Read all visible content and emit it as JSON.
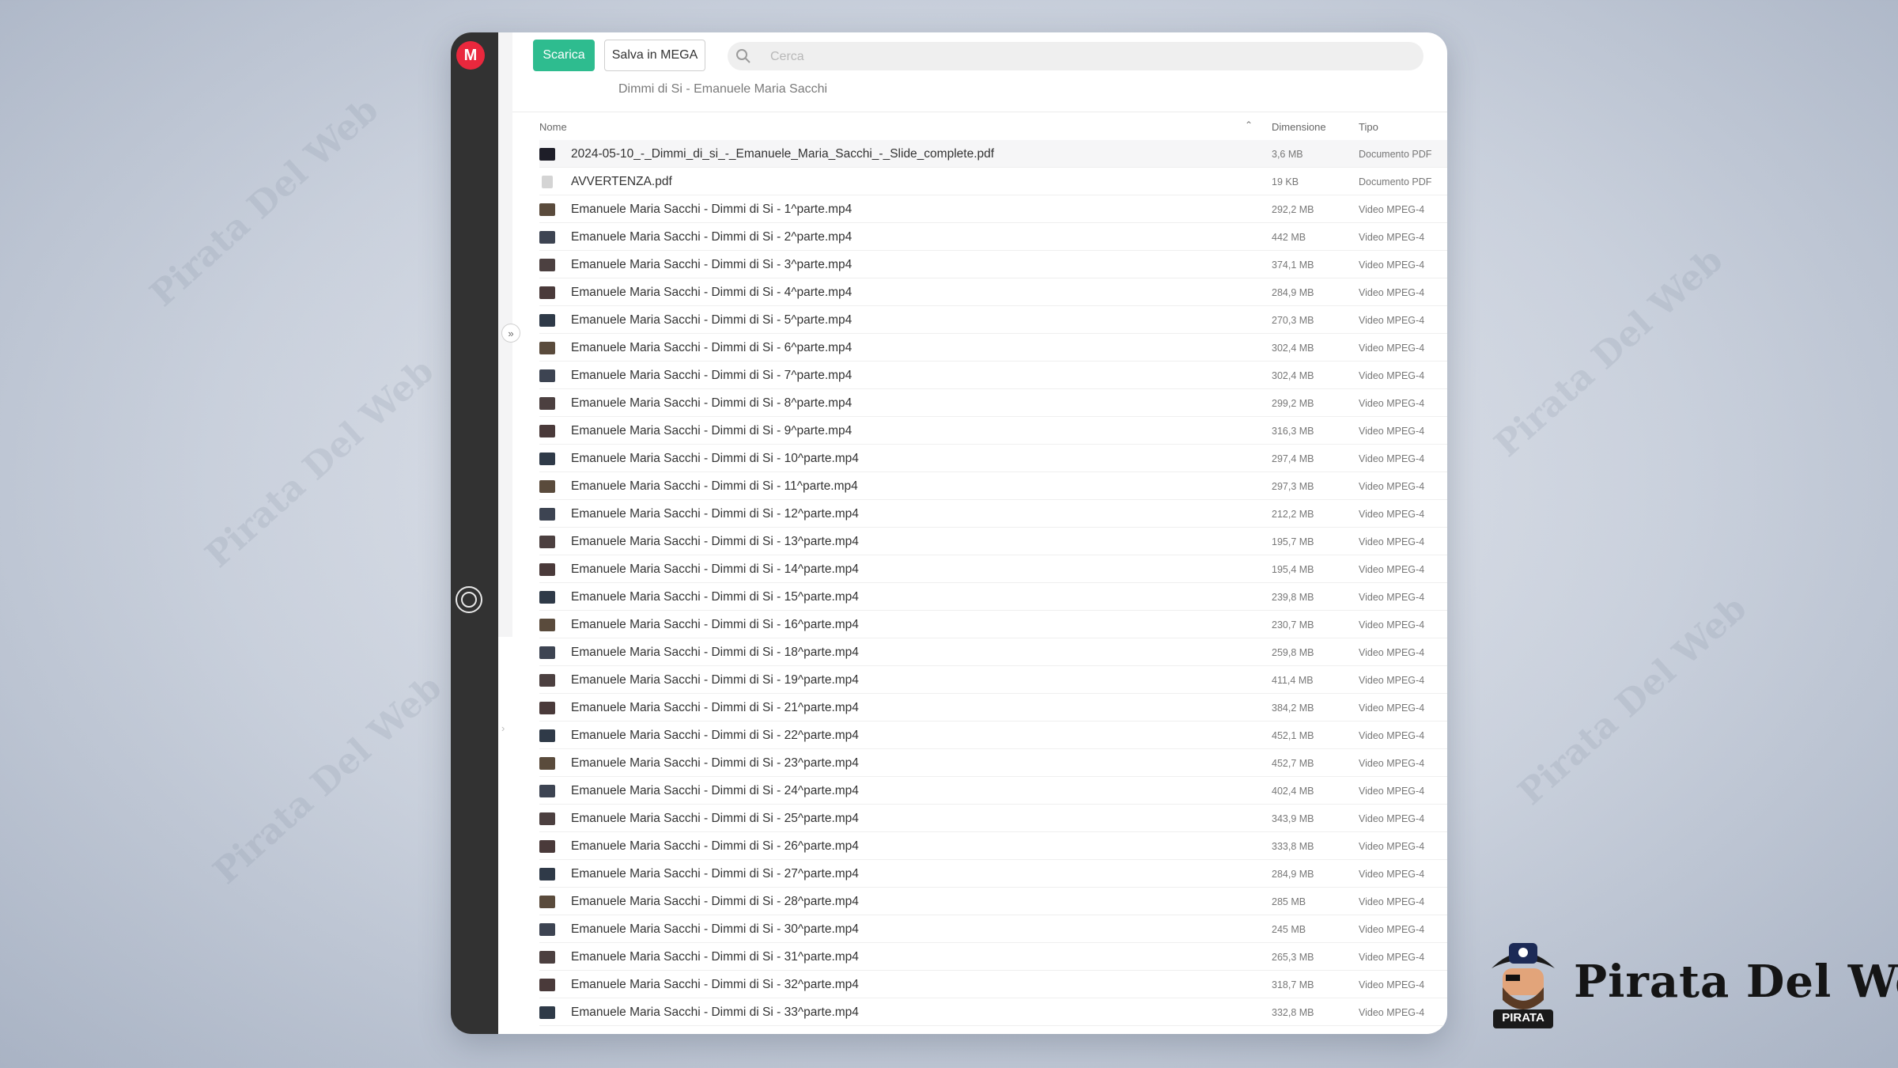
{
  "watermark_text": "Pirata Del Web",
  "app": {
    "logo_letter": "M"
  },
  "toolbar": {
    "download_label": "Scarica",
    "save_label": "Salva in MEGA",
    "search_placeholder": "Cerca"
  },
  "breadcrumb": "Dimmi di Si - Emanuele Maria Sacchi",
  "columns": {
    "name": "Nome",
    "size": "Dimensione",
    "type": "Tipo"
  },
  "files": [
    {
      "name": "2024-05-10_-_Dimmi_di_si_-_Emanuele_Maria_Sacchi_-_Slide_complete.pdf",
      "size": "3,6 MB",
      "type": "Documento PDF"
    },
    {
      "name": "AVVERTENZA.pdf",
      "size": "19 KB",
      "type": "Documento PDF"
    },
    {
      "name": "Emanuele Maria Sacchi - Dimmi di Si - 1^parte.mp4",
      "size": "292,2 MB",
      "type": "Video MPEG-4"
    },
    {
      "name": "Emanuele Maria Sacchi - Dimmi di Si - 2^parte.mp4",
      "size": "442 MB",
      "type": "Video MPEG-4"
    },
    {
      "name": "Emanuele Maria Sacchi - Dimmi di Si - 3^parte.mp4",
      "size": "374,1 MB",
      "type": "Video MPEG-4"
    },
    {
      "name": "Emanuele Maria Sacchi - Dimmi di Si - 4^parte.mp4",
      "size": "284,9 MB",
      "type": "Video MPEG-4"
    },
    {
      "name": "Emanuele Maria Sacchi - Dimmi di Si - 5^parte.mp4",
      "size": "270,3 MB",
      "type": "Video MPEG-4"
    },
    {
      "name": "Emanuele Maria Sacchi - Dimmi di Si - 6^parte.mp4",
      "size": "302,4 MB",
      "type": "Video MPEG-4"
    },
    {
      "name": "Emanuele Maria Sacchi - Dimmi di Si - 7^parte.mp4",
      "size": "302,4 MB",
      "type": "Video MPEG-4"
    },
    {
      "name": "Emanuele Maria Sacchi - Dimmi di Si - 8^parte.mp4",
      "size": "299,2 MB",
      "type": "Video MPEG-4"
    },
    {
      "name": "Emanuele Maria Sacchi - Dimmi di Si - 9^parte.mp4",
      "size": "316,3 MB",
      "type": "Video MPEG-4"
    },
    {
      "name": "Emanuele Maria Sacchi - Dimmi di Si - 10^parte.mp4",
      "size": "297,4 MB",
      "type": "Video MPEG-4"
    },
    {
      "name": "Emanuele Maria Sacchi - Dimmi di Si - 11^parte.mp4",
      "size": "297,3 MB",
      "type": "Video MPEG-4"
    },
    {
      "name": "Emanuele Maria Sacchi - Dimmi di Si - 12^parte.mp4",
      "size": "212,2 MB",
      "type": "Video MPEG-4"
    },
    {
      "name": "Emanuele Maria Sacchi - Dimmi di Si - 13^parte.mp4",
      "size": "195,7 MB",
      "type": "Video MPEG-4"
    },
    {
      "name": "Emanuele Maria Sacchi - Dimmi di Si - 14^parte.mp4",
      "size": "195,4 MB",
      "type": "Video MPEG-4"
    },
    {
      "name": "Emanuele Maria Sacchi - Dimmi di Si - 15^parte.mp4",
      "size": "239,8 MB",
      "type": "Video MPEG-4"
    },
    {
      "name": "Emanuele Maria Sacchi - Dimmi di Si - 16^parte.mp4",
      "size": "230,7 MB",
      "type": "Video MPEG-4"
    },
    {
      "name": "Emanuele Maria Sacchi - Dimmi di Si - 18^parte.mp4",
      "size": "259,8 MB",
      "type": "Video MPEG-4"
    },
    {
      "name": "Emanuele Maria Sacchi - Dimmi di Si - 19^parte.mp4",
      "size": "411,4 MB",
      "type": "Video MPEG-4"
    },
    {
      "name": "Emanuele Maria Sacchi - Dimmi di Si - 21^parte.mp4",
      "size": "384,2 MB",
      "type": "Video MPEG-4"
    },
    {
      "name": "Emanuele Maria Sacchi - Dimmi di Si - 22^parte.mp4",
      "size": "452,1 MB",
      "type": "Video MPEG-4"
    },
    {
      "name": "Emanuele Maria Sacchi - Dimmi di Si - 23^parte.mp4",
      "size": "452,7 MB",
      "type": "Video MPEG-4"
    },
    {
      "name": "Emanuele Maria Sacchi - Dimmi di Si - 24^parte.mp4",
      "size": "402,4 MB",
      "type": "Video MPEG-4"
    },
    {
      "name": "Emanuele Maria Sacchi - Dimmi di Si - 25^parte.mp4",
      "size": "343,9 MB",
      "type": "Video MPEG-4"
    },
    {
      "name": "Emanuele Maria Sacchi - Dimmi di Si - 26^parte.mp4",
      "size": "333,8 MB",
      "type": "Video MPEG-4"
    },
    {
      "name": "Emanuele Maria Sacchi - Dimmi di Si - 27^parte.mp4",
      "size": "284,9 MB",
      "type": "Video MPEG-4"
    },
    {
      "name": "Emanuele Maria Sacchi - Dimmi di Si - 28^parte.mp4",
      "size": "285 MB",
      "type": "Video MPEG-4"
    },
    {
      "name": "Emanuele Maria Sacchi - Dimmi di Si - 30^parte.mp4",
      "size": "245 MB",
      "type": "Video MPEG-4"
    },
    {
      "name": "Emanuele Maria Sacchi - Dimmi di Si - 31^parte.mp4",
      "size": "265,3 MB",
      "type": "Video MPEG-4"
    },
    {
      "name": "Emanuele Maria Sacchi - Dimmi di Si - 32^parte.mp4",
      "size": "318,7 MB",
      "type": "Video MPEG-4"
    },
    {
      "name": "Emanuele Maria Sacchi - Dimmi di Si - 33^parte.mp4",
      "size": "332,8 MB",
      "type": "Video MPEG-4"
    }
  ],
  "brand": {
    "name": "Pirata Del Web",
    "badge": "PIRATA"
  },
  "colors": {
    "accent": "#2ebc8f",
    "mega_red": "#e9283d",
    "sidebar": "#323232"
  }
}
